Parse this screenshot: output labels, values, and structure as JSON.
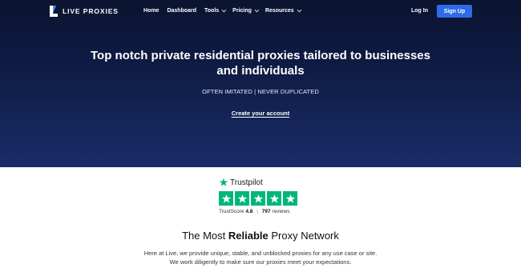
{
  "nav": {
    "brand": "LIVE PROXIES",
    "items": [
      {
        "label": "Home",
        "dropdown": false
      },
      {
        "label": "Dashboard",
        "dropdown": false
      },
      {
        "label": "Tools",
        "dropdown": true
      },
      {
        "label": "Pricing",
        "dropdown": true
      },
      {
        "label": "Resources",
        "dropdown": true
      }
    ],
    "login_label": "Log In",
    "signup_label": "Sign Up"
  },
  "hero": {
    "title": "Top notch private residential proxies tailored to businesses and individuals",
    "subtitle": "OFTEN IMITATED | NEVER DUPLICATED",
    "cta_label": "Create your account"
  },
  "trustpilot": {
    "name": "Trustpilot",
    "score_label": "TrustScore",
    "score": "4.8",
    "reviews": "797",
    "reviews_label": "reviews",
    "stars": 5
  },
  "network": {
    "title_pre": "The Most ",
    "title_bold": "Reliable",
    "title_post": " Proxy Network",
    "desc_line1": "Here at Live, we provide unique, stable, and unblocked proxies for any use case or site.",
    "desc_line2": "We work diligently to make sure our proxies meet your expectations."
  },
  "colors": {
    "hero_bg": "#0e1b44",
    "accent": "#2f6be8",
    "trustpilot_green": "#00b67a"
  }
}
